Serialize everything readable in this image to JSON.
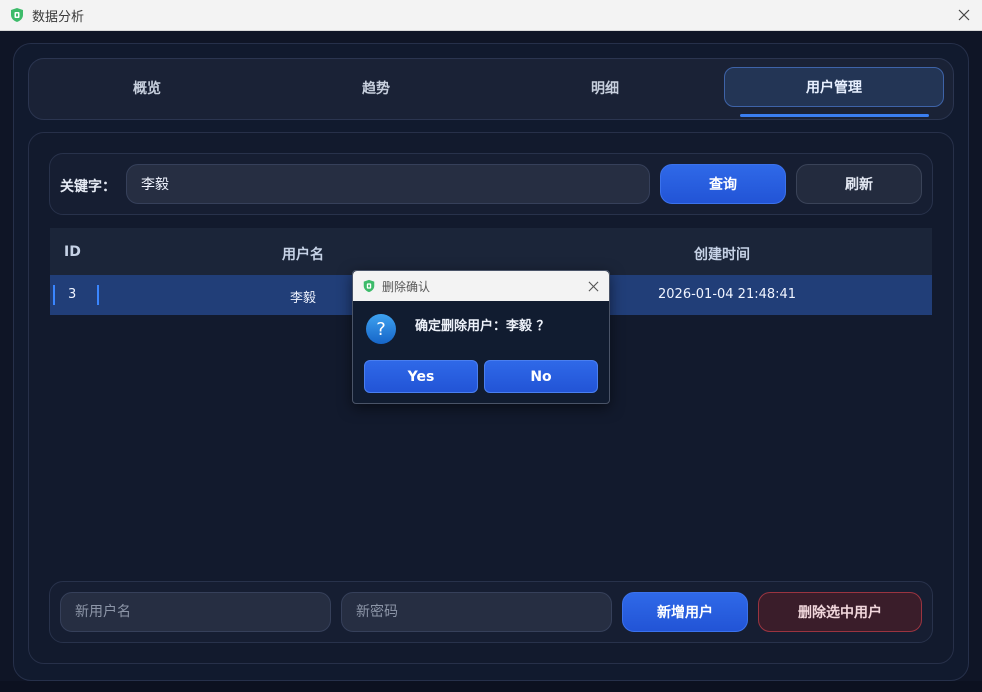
{
  "window": {
    "title": "数据分析"
  },
  "tabs": [
    {
      "label": "概览"
    },
    {
      "label": "趋势"
    },
    {
      "label": "明细"
    },
    {
      "label": "用户管理"
    }
  ],
  "search": {
    "label": "关键字：",
    "value": "李毅",
    "query_button": "查询",
    "refresh_button": "刷新"
  },
  "table": {
    "columns": [
      "ID",
      "用户名",
      "创建时间"
    ],
    "rows": [
      {
        "id": "3",
        "username": "李毅",
        "created": "2026-01-04 21:48:41"
      }
    ]
  },
  "bottom": {
    "new_username_placeholder": "新用户名",
    "new_password_placeholder": "新密码",
    "add_button": "新增用户",
    "delete_button": "删除选中用户"
  },
  "dialog": {
    "title": "删除确认",
    "message": "确定删除用户：李毅 ？",
    "yes": "Yes",
    "no": "No"
  },
  "colors": {
    "accent": "#2f69e8",
    "danger_border": "#9b3440",
    "selected_row": "#213e78"
  }
}
